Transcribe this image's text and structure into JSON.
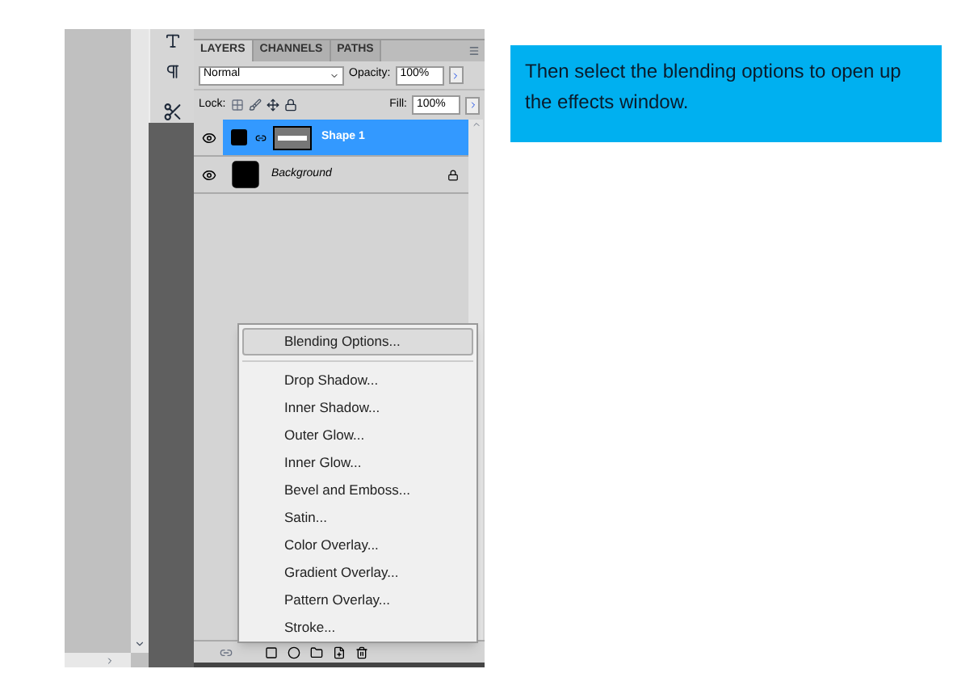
{
  "panel": {
    "tabs": [
      {
        "label": "LAYERS",
        "selected": true
      },
      {
        "label": "CHANNELS",
        "selected": false
      },
      {
        "label": "PATHS",
        "selected": false
      }
    ],
    "blend_mode": "Normal",
    "opacity_label": "Opacity:",
    "opacity": "100%",
    "lock_label": "Lock:",
    "fill_label": "Fill:",
    "fill": "100%",
    "layers": [
      {
        "name": "Shape 1",
        "selected": true,
        "mask": true,
        "locked": false
      },
      {
        "name": "Background",
        "selected": false,
        "mask": false,
        "locked": true
      }
    ]
  },
  "context_menu": {
    "sections": [
      [
        {
          "label": "Blending Options...",
          "selected": true
        }
      ],
      [
        {
          "label": "Drop Shadow...",
          "selected": false
        },
        {
          "label": "Inner Shadow...",
          "selected": false
        },
        {
          "label": "Outer Glow...",
          "selected": false
        },
        {
          "label": "Inner Glow...",
          "selected": false
        },
        {
          "label": "Bevel and Emboss...",
          "selected": false
        },
        {
          "label": "Satin...",
          "selected": false
        },
        {
          "label": "Color Overlay...",
          "selected": false
        },
        {
          "label": "Gradient Overlay...",
          "selected": false
        },
        {
          "label": "Pattern Overlay...",
          "selected": false
        },
        {
          "label": "Stroke...",
          "selected": false
        }
      ]
    ]
  },
  "callout": {
    "text": "Then select the blending options to open up the effects window."
  }
}
